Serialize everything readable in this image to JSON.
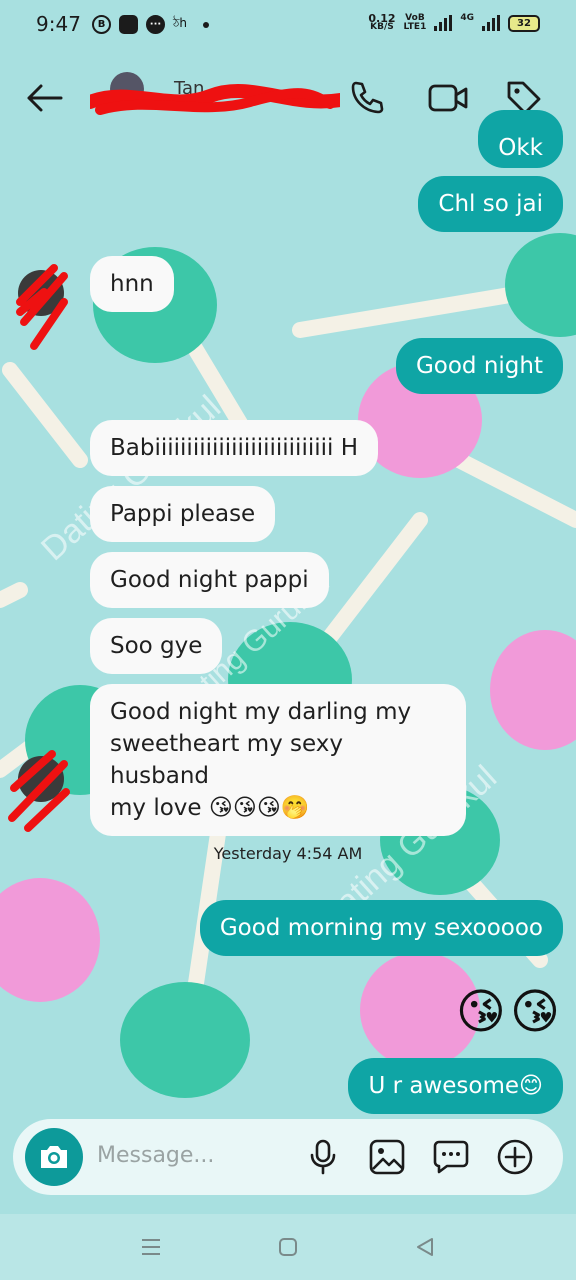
{
  "status": {
    "time": "9:47",
    "icons": [
      "B",
      "",
      "···",
      "ঠh"
    ],
    "net_speed_value": "0.12",
    "net_speed_unit": "KB/S",
    "volte_top": "VoB",
    "volte_bottom": "LTE1",
    "network_tag": "4G",
    "battery": "32"
  },
  "header": {
    "contact_name": "Tan"
  },
  "messages": [
    {
      "dir": "out",
      "text": "Okk"
    },
    {
      "dir": "out",
      "text": "Chl so jai"
    },
    {
      "dir": "in",
      "text": "hnn"
    },
    {
      "dir": "out",
      "text": "Good night"
    },
    {
      "dir": "in",
      "text": "Babiiiiiiiiiiiiiiiiiiiiiiiiiiii H"
    },
    {
      "dir": "in",
      "text": "Pappi please"
    },
    {
      "dir": "in",
      "text": "Good night pappi"
    },
    {
      "dir": "in",
      "text": "Soo gye"
    },
    {
      "dir": "in",
      "text": "Good night my darling my\nsweetheart my sexy husband\nmy love 😘😘😘🤭"
    },
    {
      "dir": "out",
      "text": "Good morning my sexooooo"
    },
    {
      "dir": "out",
      "text": "U r awesome😊"
    }
  ],
  "timestamp": "Yesterday 4:54 AM",
  "emoji_message": "😘😘",
  "watermarks": [
    "Dating Gurukul",
    "Dating Gurukul",
    "Dating Gurukul"
  ],
  "composer": {
    "placeholder": "Message..."
  },
  "colors": {
    "outgoing_bubble": "#0fa5a5",
    "incoming_bubble": "#f9f9f9",
    "background": "#a8e0e0"
  }
}
